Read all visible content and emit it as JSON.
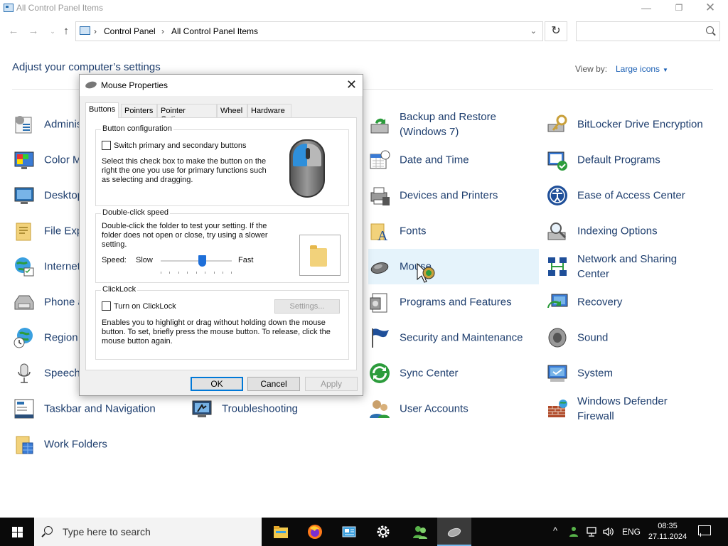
{
  "window": {
    "title": "All Control Panel Items",
    "minimize_glyph": "—",
    "maximize_glyph": "❐",
    "close_glyph": "✕"
  },
  "nav": {
    "back_glyph": "←",
    "forward_glyph": "→",
    "recent_glyph": "⌄",
    "up_glyph": "↑",
    "breadcrumbs": [
      "Control Panel",
      "All Control Panel Items"
    ],
    "separator": "›",
    "dropdown_glyph": "⌄",
    "refresh_glyph": "↻",
    "search_placeholder": ""
  },
  "header": {
    "adjust_title": "Adjust your computer’s settings",
    "view_by_label": "View by:",
    "view_by_value": "Large icons",
    "view_by_arrow": "▼"
  },
  "items": {
    "col1": [
      {
        "label": "Administrative Tools",
        "icon": "admin-tools-icon"
      },
      {
        "label": "Color Management",
        "icon": "color-management-icon"
      },
      {
        "label": "Desktop Gadgets",
        "icon": "desktop-icon"
      },
      {
        "label": "File Explorer Options",
        "icon": "file-explorer-icon"
      },
      {
        "label": "Internet Options",
        "icon": "internet-options-icon"
      },
      {
        "label": "Phone and Modem",
        "icon": "phone-modem-icon"
      },
      {
        "label": "Region",
        "icon": "region-icon"
      },
      {
        "label": "Speech Recognition",
        "icon": "speech-icon"
      },
      {
        "label": "Taskbar and Navigation",
        "icon": "taskbar-icon"
      },
      {
        "label": "Work Folders",
        "icon": "work-folders-icon"
      }
    ],
    "col2": [
      {
        "label": "Troubleshooting",
        "icon": "troubleshooting-icon"
      }
    ],
    "col3": [
      {
        "label": "Backup and Restore\n(Windows 7)",
        "icon": "backup-restore-icon"
      },
      {
        "label": "Date and Time",
        "icon": "date-time-icon"
      },
      {
        "label": "Devices and Printers",
        "icon": "devices-printers-icon"
      },
      {
        "label": "Fonts",
        "icon": "fonts-icon"
      },
      {
        "label": "Mouse",
        "icon": "mouse-icon"
      },
      {
        "label": "Programs and Features",
        "icon": "programs-features-icon"
      },
      {
        "label": "Security and Maintenance",
        "icon": "security-maintenance-icon"
      },
      {
        "label": "Sync Center",
        "icon": "sync-center-icon"
      },
      {
        "label": "User Accounts",
        "icon": "user-accounts-icon"
      }
    ],
    "col4": [
      {
        "label": "BitLocker Drive Encryption",
        "icon": "bitlocker-icon"
      },
      {
        "label": "Default Programs",
        "icon": "default-programs-icon"
      },
      {
        "label": "Ease of Access Center",
        "icon": "ease-of-access-icon"
      },
      {
        "label": "Indexing Options",
        "icon": "indexing-icon"
      },
      {
        "label": "Network and Sharing\nCenter",
        "icon": "network-sharing-icon"
      },
      {
        "label": "Recovery",
        "icon": "recovery-icon"
      },
      {
        "label": "Sound",
        "icon": "sound-icon"
      },
      {
        "label": "System",
        "icon": "system-icon"
      },
      {
        "label": "Windows Defender\nFirewall",
        "icon": "firewall-icon"
      }
    ]
  },
  "dialog": {
    "title": "Mouse Properties",
    "close_glyph": "✕",
    "tabs": [
      "Buttons",
      "Pointers",
      "Pointer Options",
      "Wheel",
      "Hardware"
    ],
    "active_tab": "Buttons",
    "button_config": {
      "title": "Button configuration",
      "checkbox_label": "Switch primary and secondary buttons",
      "checked": false,
      "description": "Select this check box to make the button on the right the one you use for primary functions such as selecting and dragging."
    },
    "double_click": {
      "title": "Double-click speed",
      "description": "Double-click the folder to test your setting. If the folder does not open or close, try using a slower setting.",
      "speed_label": "Speed:",
      "slow_label": "Slow",
      "fast_label": "Fast",
      "speed_fraction": 0.58
    },
    "clicklock": {
      "title": "ClickLock",
      "checkbox_label": "Turn on ClickLock",
      "checked": false,
      "settings_button": "Settings...",
      "description": "Enables you to highlight or drag without holding down the mouse button. To set, briefly press the mouse button. To release, click the mouse button again."
    },
    "buttons": {
      "ok": "OK",
      "cancel": "Cancel",
      "apply": "Apply"
    }
  },
  "taskbar": {
    "search_placeholder": "Type here to search",
    "apps": [
      "file-explorer-icon",
      "firefox-icon",
      "control-panel-icon",
      "settings-gear-icon",
      "users-icon",
      "mouse-icon"
    ],
    "tray": {
      "chevron": "^",
      "language": "ENG",
      "time": "08:35",
      "date": "27.11.2024"
    }
  },
  "colors": {
    "link_blue": "#1e3e6e",
    "accent": "#0078d7",
    "selected_item_bg": "#e5f3fb",
    "taskbar": "#0a0a0a"
  }
}
